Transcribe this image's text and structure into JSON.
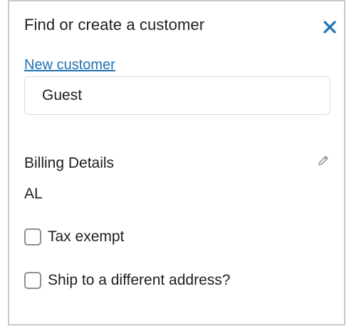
{
  "panel": {
    "title": "Find or create a customer",
    "close_icon": "close-icon",
    "accent_color": "#2271b1"
  },
  "customer": {
    "new_customer_link": "New customer",
    "search_value": "Guest"
  },
  "billing": {
    "title": "Billing Details",
    "edit_icon": "pencil-icon",
    "value": "AL"
  },
  "options": {
    "tax_exempt": {
      "label": "Tax exempt",
      "checked": false
    },
    "ship_different": {
      "label": "Ship to a different address?",
      "checked": false
    }
  }
}
